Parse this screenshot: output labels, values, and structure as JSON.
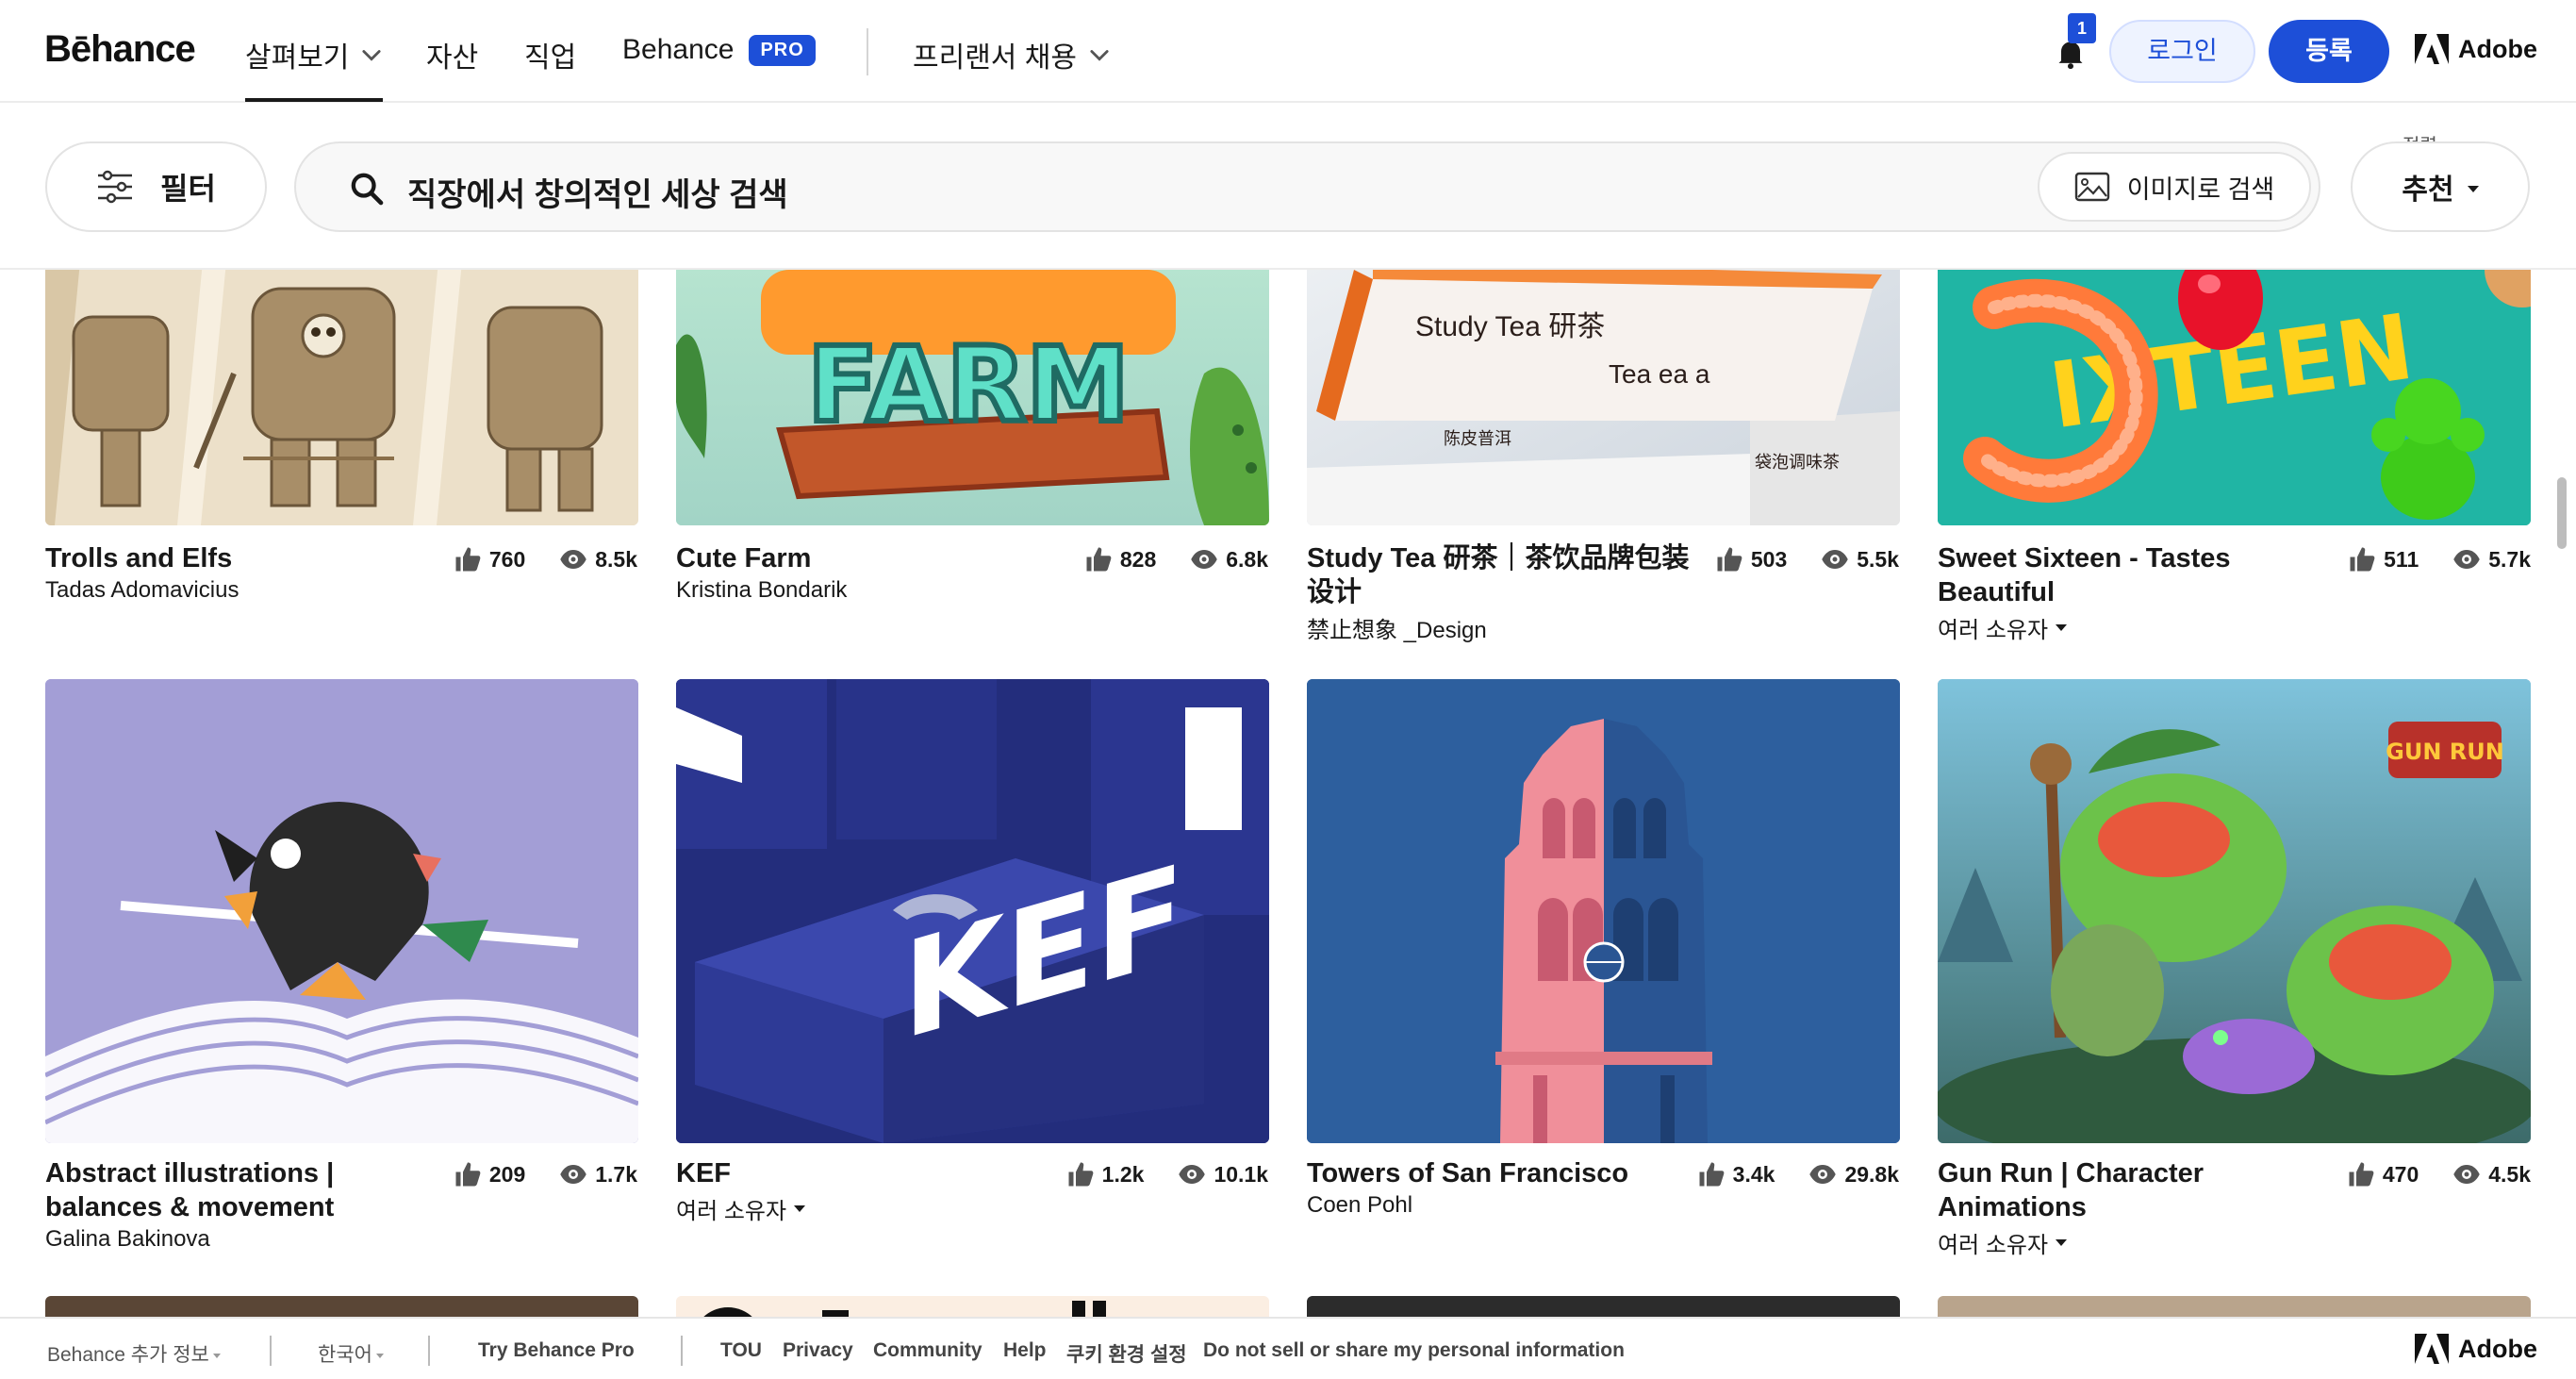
{
  "topnav": {
    "logo": "Bēhance",
    "explore": "살펴보기",
    "assets": "자산",
    "jobs": "직업",
    "behance": "Behance",
    "pro_badge": "PRO",
    "freelance": "프리랜서 채용",
    "notifications_count": "1",
    "login": "로그인",
    "signup": "등록",
    "adobe": "Adobe"
  },
  "search": {
    "filter_label": "필터",
    "placeholder": "직장에서 창의적인 세상 검색",
    "image_search": "이미지로 검색",
    "sort_label": "정렬",
    "sort_value": "추천"
  },
  "projects": [
    {
      "title": "Trolls and Elfs",
      "owner": "Tadas Adomavicius",
      "appreciations": "760",
      "views": "8.5k"
    },
    {
      "title": "Cute Farm",
      "owner": "Kristina Bondarik",
      "appreciations": "828",
      "views": "6.8k"
    },
    {
      "title": "Study Tea 研茶｜茶饮品牌包装设计",
      "owner": "禁止想象 _Design",
      "appreciations": "503",
      "views": "5.5k"
    },
    {
      "title": "Sweet Sixteen - Tastes Beautiful",
      "owner": "여러 소유자",
      "appreciations": "511",
      "views": "5.7k"
    },
    {
      "title": "Abstract illustrations | balances & movement",
      "owner": "Galina Bakinova",
      "appreciations": "209",
      "views": "1.7k"
    },
    {
      "title": "KEF",
      "owner": "여러 소유자",
      "appreciations": "1.2k",
      "views": "10.1k"
    },
    {
      "title": "Towers of San Francisco",
      "owner": "Coen Pohl",
      "appreciations": "3.4k",
      "views": "29.8k"
    },
    {
      "title": "Gun Run | Character Animations",
      "owner": "여러 소유자",
      "appreciations": "470",
      "views": "4.5k"
    }
  ],
  "thumb_text": {
    "farm": "FARM",
    "study_tea": "Study Tea 研茶",
    "tea": "Tea     ea     a",
    "tea_left": "陈皮普洱",
    "tea_right": "袋泡调味茶",
    "sixteen": "IXTEEN",
    "kef": "KEF",
    "gunrun": "GUN RUN"
  },
  "footer": {
    "more_info": "Behance 추가 정보",
    "language": "한국어",
    "try_pro": "Try Behance Pro",
    "tou": "TOU",
    "privacy": "Privacy",
    "community": "Community",
    "help": "Help",
    "cookie": "쿠키 환경 설정",
    "do_not_sell": "Do not sell or share my personal information",
    "adobe": "Adobe"
  },
  "colors": {
    "accent": "#1d4fd8",
    "text": "#191919"
  }
}
